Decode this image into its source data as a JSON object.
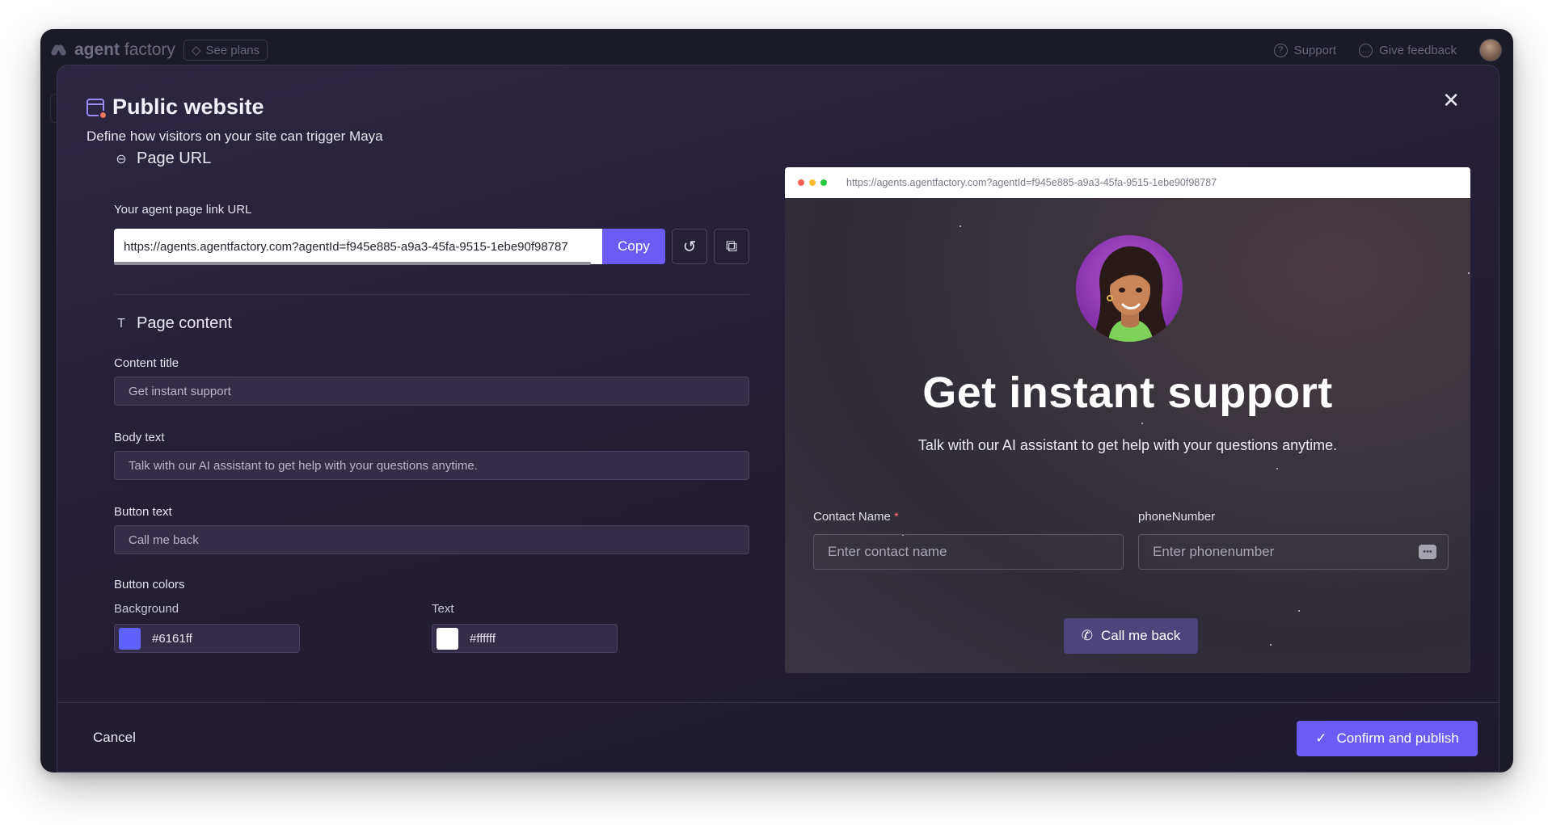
{
  "app": {
    "brand_bold": "agent",
    "brand_light": "factory",
    "see_plans": "See plans",
    "support": "Support",
    "give_feedback": "Give feedback"
  },
  "modal": {
    "title": "Public website",
    "subtitle": "Define how visitors on your site can trigger Maya",
    "page_url_heading": "Page URL",
    "url_label": "Your agent page link URL",
    "url_value": "https://agents.agentfactory.com?agentId=f945e885-a9a3-45fa-9515-1ebe90f98787",
    "copy_label": "Copy",
    "page_content_heading": "Page content",
    "content_title_label": "Content title",
    "content_title_value": "Get instant support",
    "body_text_label": "Body text",
    "body_text_value": "Talk with our AI assistant to get help with your questions anytime.",
    "button_text_label": "Button text",
    "button_text_value": "Call me back",
    "button_colors_label": "Button colors",
    "background_label": "Background",
    "background_value": "#6161ff",
    "text_label": "Text",
    "text_value": "#ffffff",
    "cancel_label": "Cancel",
    "confirm_label": "Confirm and publish"
  },
  "preview": {
    "url": "https://agents.agentfactory.com?agentId=f945e885-a9a3-45fa-9515-1ebe90f98787",
    "title": "Get instant support",
    "body": "Talk with our AI assistant to get help with your questions anytime.",
    "contact_label": "Contact Name",
    "contact_required": "*",
    "contact_placeholder": "Enter contact name",
    "phone_label": "phoneNumber",
    "phone_placeholder": "Enter phonenumber",
    "button_label": "Call me back"
  },
  "colors": {
    "accent": "#6c5cf5",
    "button_bg": "#6161ff",
    "button_text": "#ffffff"
  }
}
